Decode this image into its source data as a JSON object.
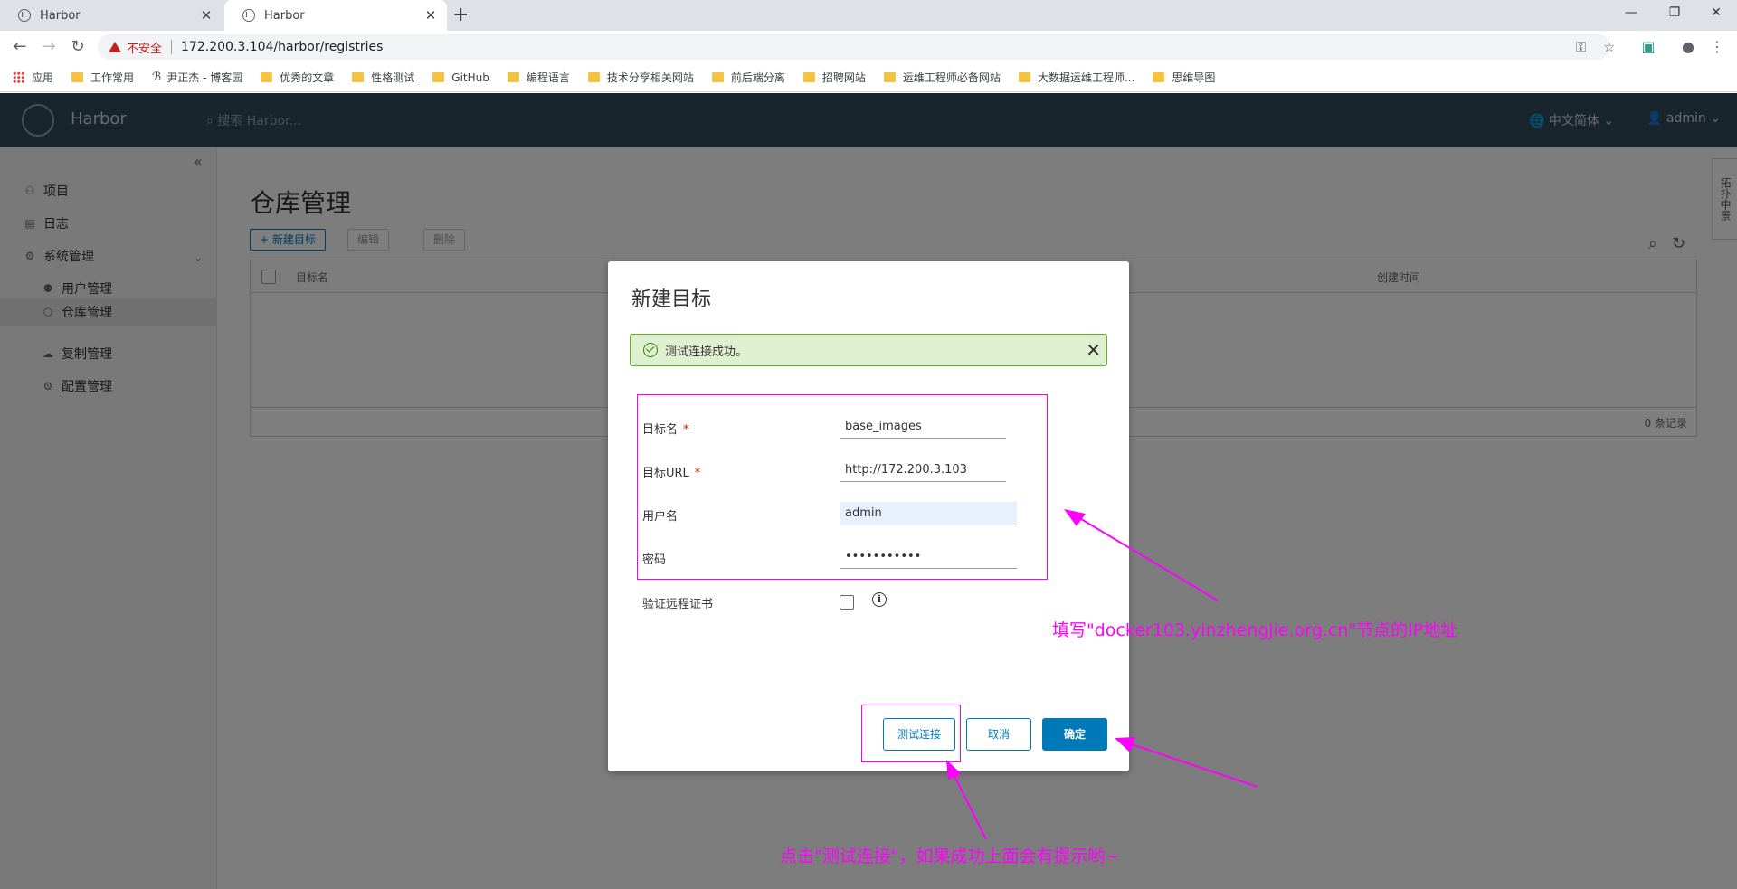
{
  "browser": {
    "tabs": [
      {
        "title": "Harbor",
        "close": "✕"
      },
      {
        "title": "Harbor",
        "close": "✕"
      }
    ],
    "new_tab": "+",
    "window_controls": {
      "minimize": "—",
      "restore": "❐",
      "close": "✕"
    },
    "security_label": "不安全",
    "url": "172.200.3.104/harbor/registries",
    "bookmarks": [
      {
        "label": "应用",
        "icon": "apps-grid-icon"
      },
      {
        "label": "工作常用",
        "icon": "folder-icon"
      },
      {
        "label": "尹正杰 - 博客园",
        "icon": "blog-icon"
      },
      {
        "label": "优秀的文章",
        "icon": "folder-icon"
      },
      {
        "label": "性格测试",
        "icon": "folder-icon"
      },
      {
        "label": "GitHub",
        "icon": "folder-icon"
      },
      {
        "label": "编程语言",
        "icon": "folder-icon"
      },
      {
        "label": "技术分享相关网站",
        "icon": "folder-icon"
      },
      {
        "label": "前后端分离",
        "icon": "folder-icon"
      },
      {
        "label": "招聘网站",
        "icon": "folder-icon"
      },
      {
        "label": "运维工程师必备网站",
        "icon": "folder-icon"
      },
      {
        "label": "大数据运维工程师...",
        "icon": "folder-icon"
      },
      {
        "label": "思维导图",
        "icon": "folder-icon"
      }
    ]
  },
  "harbor": {
    "brand": "Harbor",
    "search_placeholder": "搜索 Harbor...",
    "language": "中文简体",
    "user": "admin",
    "sidebar": {
      "items": [
        {
          "label": "项目"
        },
        {
          "label": "日志"
        },
        {
          "label": "系统管理"
        }
      ],
      "sub_items": [
        {
          "label": "用户管理"
        },
        {
          "label": "仓库管理"
        },
        {
          "label": "复制管理"
        },
        {
          "label": "配置管理"
        }
      ]
    },
    "page_title": "仓库管理",
    "actions": {
      "new": "+ 新建目标",
      "edit": "编辑",
      "delete": "删除"
    },
    "table": {
      "col_name": "目标名",
      "col_created": "创建时间",
      "footer": "0 条记录"
    },
    "right_tab": "拓扑中景"
  },
  "modal": {
    "title": "新建目标",
    "alert": "测试连接成功。",
    "fields": {
      "name_label": "目标名",
      "name_value": "base_images",
      "url_label": "目标URL",
      "url_value": "http://172.200.3.103",
      "user_label": "用户名",
      "user_value": "admin",
      "password_label": "密码",
      "password_value": "•••••••••••",
      "verify_label": "验证远程证书"
    },
    "required_mark": "*",
    "buttons": {
      "test": "测试连接",
      "cancel": "取消",
      "ok": "确定"
    }
  },
  "annotations": {
    "note_ip": "填写\"docker103.yinzhengjie.org.cn\"节点的IP地址",
    "note_test": "点击\"测试连接\"，如果成功上面会有提示哟~",
    "color": "#ff00ff"
  }
}
